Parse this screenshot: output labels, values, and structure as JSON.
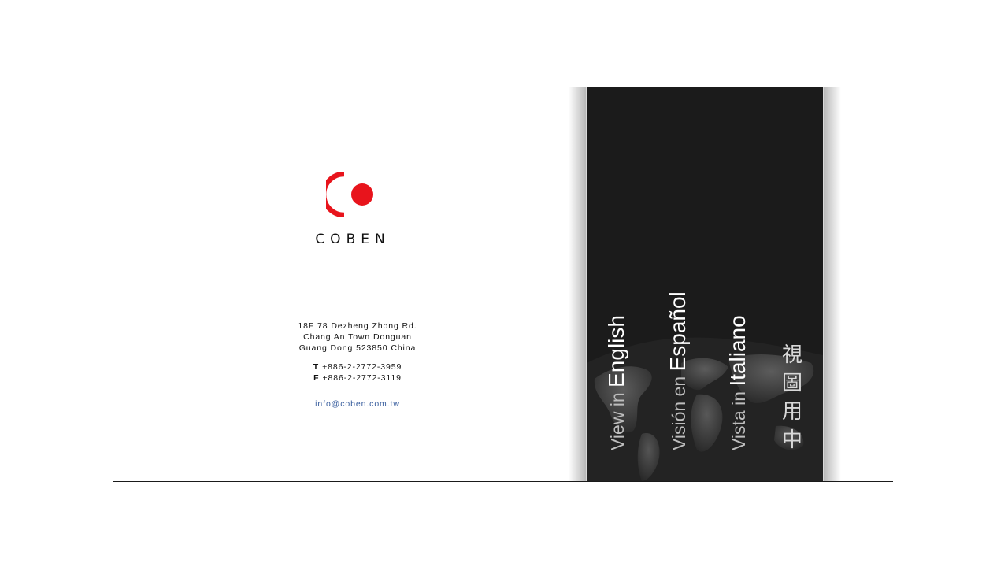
{
  "brand": {
    "wordmark": "COBEN",
    "colors": {
      "logo_red": "#e8141c",
      "panel_dark": "#1b1b1b",
      "link_blue": "#3a5f9f"
    }
  },
  "contact": {
    "address_lines": [
      "18F 78 Dezheng Zhong Rd.",
      "Chang An Town Donguan",
      "Guang Dong 523850 China"
    ],
    "phone": {
      "label": "T",
      "value": "+886-2-2772-3959"
    },
    "fax": {
      "label": "F",
      "value": "+886-2-2772-3119"
    },
    "email": "info@coben.com.tw"
  },
  "languages": {
    "english": {
      "prefix": "View in ",
      "name": "English"
    },
    "spanish": {
      "prefix": "Visión en ",
      "name": "Español"
    },
    "italian": {
      "prefix": "Vista in ",
      "name": "Italiano"
    },
    "chinese": {
      "chars": [
        "視",
        "圖",
        "用",
        "中"
      ]
    }
  },
  "icons": {
    "logo": "coben-logo-icon",
    "background": "world-map-icon"
  }
}
